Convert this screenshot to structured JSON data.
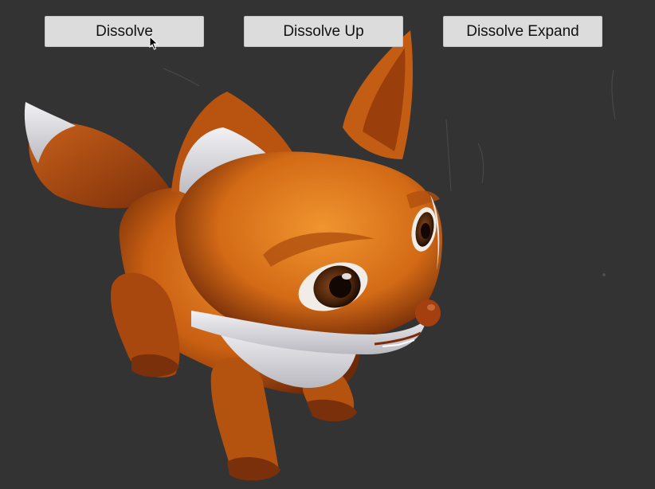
{
  "buttons": {
    "dissolve": "Dissolve",
    "dissolve_up": "Dissolve Up",
    "dissolve_expand": "Dissolve Expand"
  },
  "colors": {
    "background": "#333333",
    "button": "#dcdcdc",
    "fox_fur": "#d86a14",
    "fox_white": "#e6e6ea"
  },
  "icons": {
    "cursor": "mouse-pointer-icon"
  }
}
